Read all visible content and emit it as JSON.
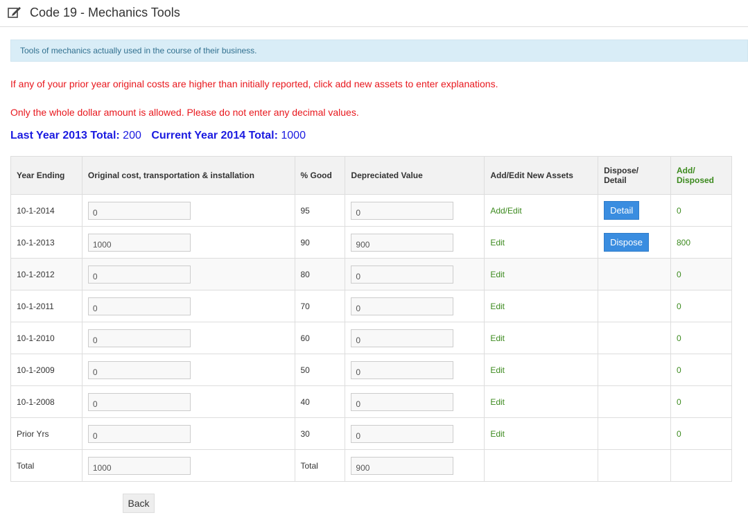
{
  "header": {
    "title": "Code 19 - Mechanics Tools",
    "icon": "edit-icon"
  },
  "info": "Tools of mechanics actually used in the course of their business.",
  "notices": [
    "If any of your prior year original costs are higher than initially reported, click add new assets to enter explanations.",
    "Only the whole dollar amount is allowed. Please do not enter any decimal values."
  ],
  "totals": {
    "last_label": "Last Year 2013 Total:",
    "last_value": "200",
    "current_label": "Current Year 2014 Total:",
    "current_value": "1000"
  },
  "table": {
    "headers": {
      "year": "Year Ending",
      "cost": "Original cost, transportation & installation",
      "good": "% Good",
      "depreciated": "Depreciated Value",
      "add_edit": "Add/Edit New Assets",
      "dispose_1": "Dispose/",
      "dispose_2": "Detail",
      "add_disposed_1": "Add/",
      "add_disposed_2": "Disposed"
    },
    "rows": [
      {
        "year": "10-1-2014",
        "cost": "0",
        "good": "95",
        "depreciated": "0",
        "link": "Add/Edit",
        "action": "Detail",
        "disposed": "0"
      },
      {
        "year": "10-1-2013",
        "cost": "1000",
        "good": "90",
        "depreciated": "900",
        "link": "Edit",
        "action": "Dispose",
        "disposed": "800"
      },
      {
        "year": "10-1-2012",
        "cost": "0",
        "good": "80",
        "depreciated": "0",
        "link": "Edit",
        "action": "",
        "disposed": "0"
      },
      {
        "year": "10-1-2011",
        "cost": "0",
        "good": "70",
        "depreciated": "0",
        "link": "Edit",
        "action": "",
        "disposed": "0"
      },
      {
        "year": "10-1-2010",
        "cost": "0",
        "good": "60",
        "depreciated": "0",
        "link": "Edit",
        "action": "",
        "disposed": "0"
      },
      {
        "year": "10-1-2009",
        "cost": "0",
        "good": "50",
        "depreciated": "0",
        "link": "Edit",
        "action": "",
        "disposed": "0"
      },
      {
        "year": "10-1-2008",
        "cost": "0",
        "good": "40",
        "depreciated": "0",
        "link": "Edit",
        "action": "",
        "disposed": "0"
      },
      {
        "year": "Prior Yrs",
        "cost": "0",
        "good": "30",
        "depreciated": "0",
        "link": "Edit",
        "action": "",
        "disposed": "0"
      }
    ],
    "total_row": {
      "label": "Total",
      "cost": "1000",
      "good_label": "Total",
      "depreciated": "900"
    }
  },
  "back_label": "Back",
  "colors": {
    "accent_blue": "#3a8de0",
    "green": "#3c8a1e",
    "red": "#e8171d",
    "totals_blue": "#1a1ae0"
  }
}
